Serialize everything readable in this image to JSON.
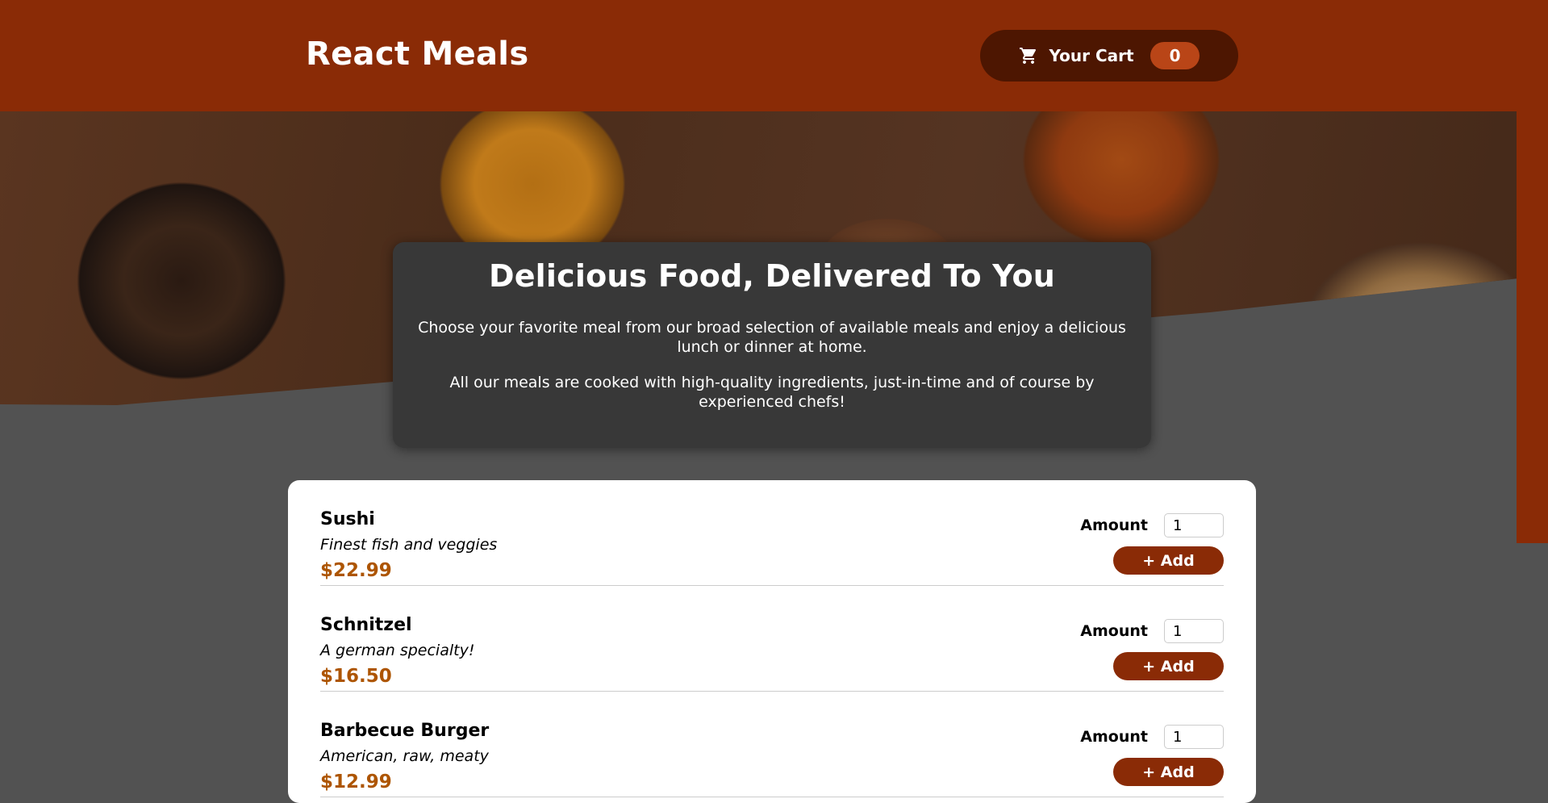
{
  "header": {
    "brand": "React Meals",
    "cart_label": "Your Cart",
    "cart_count": "0"
  },
  "summary": {
    "title": "Delicious Food, Delivered To You",
    "paragraph_1": "Choose your favorite meal from our broad selection of available meals and enjoy a delicious lunch or dinner at home.",
    "paragraph_2": "All our meals are cooked with high-quality ingredients, just-in-time and of course by experienced chefs!"
  },
  "meals": {
    "amount_label": "Amount",
    "add_label": "+ Add",
    "items": [
      {
        "name": "Sushi",
        "description": "Finest fish and veggies",
        "price": "$22.99",
        "amount": "1"
      },
      {
        "name": "Schnitzel",
        "description": "A german specialty!",
        "price": "$16.50",
        "amount": "1"
      },
      {
        "name": "Barbecue Burger",
        "description": "American, raw, meaty",
        "price": "$12.99",
        "amount": "1"
      }
    ]
  },
  "colors": {
    "header_bg": "#8a2b06",
    "cart_button_bg": "#4d1601",
    "cart_badge_bg": "#b94517",
    "page_bg": "#525252",
    "summary_bg": "#383838",
    "price": "#ad5502"
  },
  "icons": {
    "cart": "shopping-cart-icon"
  }
}
